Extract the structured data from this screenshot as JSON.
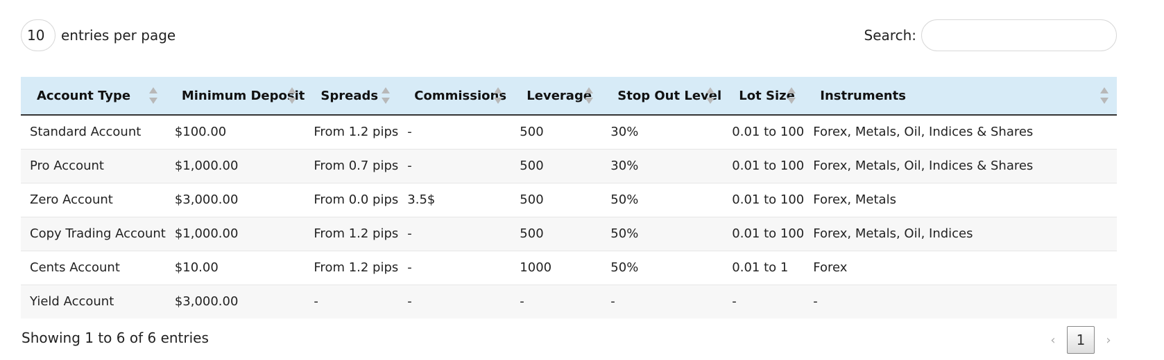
{
  "length": {
    "value": "10",
    "label": "entries per page"
  },
  "search": {
    "label": "Search:",
    "value": "",
    "placeholder": ""
  },
  "table": {
    "columns": [
      "Account Type",
      "Minimum Deposit",
      "Spreads",
      "Commissions",
      "Leverage",
      "Stop Out Level",
      "Lot Size",
      "Instruments"
    ],
    "rows": [
      [
        "Standard Account",
        "$100.00",
        "From 1.2 pips",
        "-",
        "500",
        "30%",
        "0.01 to 100",
        "Forex, Metals, Oil, Indices & Shares"
      ],
      [
        "Pro Account",
        "$1,000.00",
        "From 0.7 pips",
        "-",
        "500",
        "30%",
        "0.01 to 100",
        "Forex, Metals, Oil, Indices & Shares"
      ],
      [
        "Zero Account",
        "$3,000.00",
        "From 0.0 pips",
        "3.5$",
        "500",
        "50%",
        "0.01 to 100",
        "Forex, Metals"
      ],
      [
        "Copy Trading Account",
        "$1,000.00",
        "From 1.2 pips",
        "-",
        "500",
        "50%",
        "0.01 to 100",
        "Forex, Metals, Oil, Indices"
      ],
      [
        "Cents Account",
        "$10.00",
        "From 1.2 pips",
        "-",
        "1000",
        "50%",
        "0.01 to 1",
        "Forex"
      ],
      [
        "Yield Account",
        "$3,000.00",
        "-",
        "-",
        "-",
        "-",
        "-",
        "-"
      ]
    ]
  },
  "footer": {
    "info": "Showing 1 to 6 of 6 entries"
  },
  "pagination": {
    "prev": "‹",
    "current": "1",
    "next": "›"
  },
  "colors": {
    "header_bg": "#d7ebf7",
    "stripe": "#f7f7f7"
  },
  "icons": {
    "sort": "sort-both-icon"
  }
}
